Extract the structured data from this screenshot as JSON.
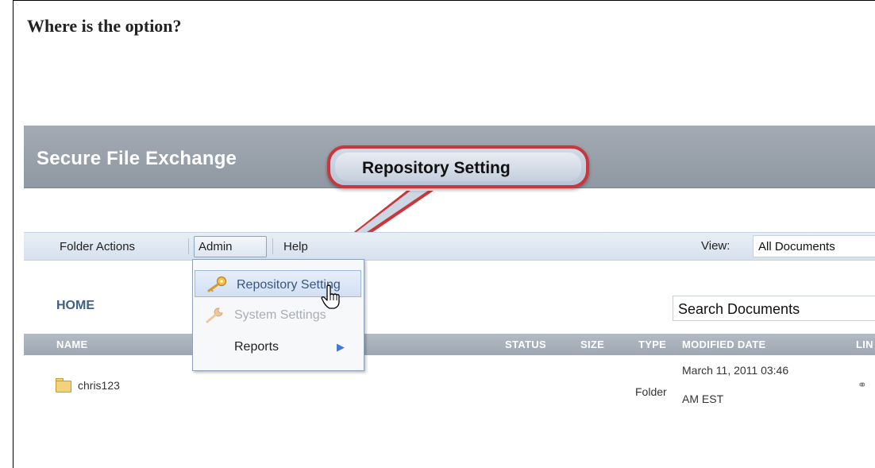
{
  "question": "Where is the option?",
  "app": {
    "title": "Secure File Exchange"
  },
  "callout": {
    "text": "Repository Setting"
  },
  "menubar": {
    "items": [
      "Folder Actions",
      "Admin",
      "Help"
    ],
    "view_label": "View:",
    "view_value": "All Documents"
  },
  "dropdown": {
    "items": [
      {
        "label": "Repository Setting",
        "icon": "key-icon",
        "state": "highlighted"
      },
      {
        "label": "System Settings",
        "icon": "wrench-icon",
        "state": "disabled"
      },
      {
        "label": "Reports",
        "icon": "submenu-arrow-icon",
        "state": "normal"
      }
    ]
  },
  "breadcrumb": "HOME",
  "search": {
    "value": "Search Documents"
  },
  "table": {
    "headers": [
      "NAME",
      "STATUS",
      "SIZE",
      "TYPE",
      "MODIFIED DATE",
      "LIN"
    ],
    "rows": [
      {
        "name": "chris123",
        "status": "",
        "size": "",
        "type": "Folder",
        "modified_line1": "March 11, 2011 03:46",
        "modified_line2": "AM EST"
      }
    ]
  },
  "colors": {
    "header_bg": "#98a1ab",
    "callout_border": "#c8373b",
    "menubar_bg": "#dfe7f2",
    "home_text": "#3e5f86"
  }
}
